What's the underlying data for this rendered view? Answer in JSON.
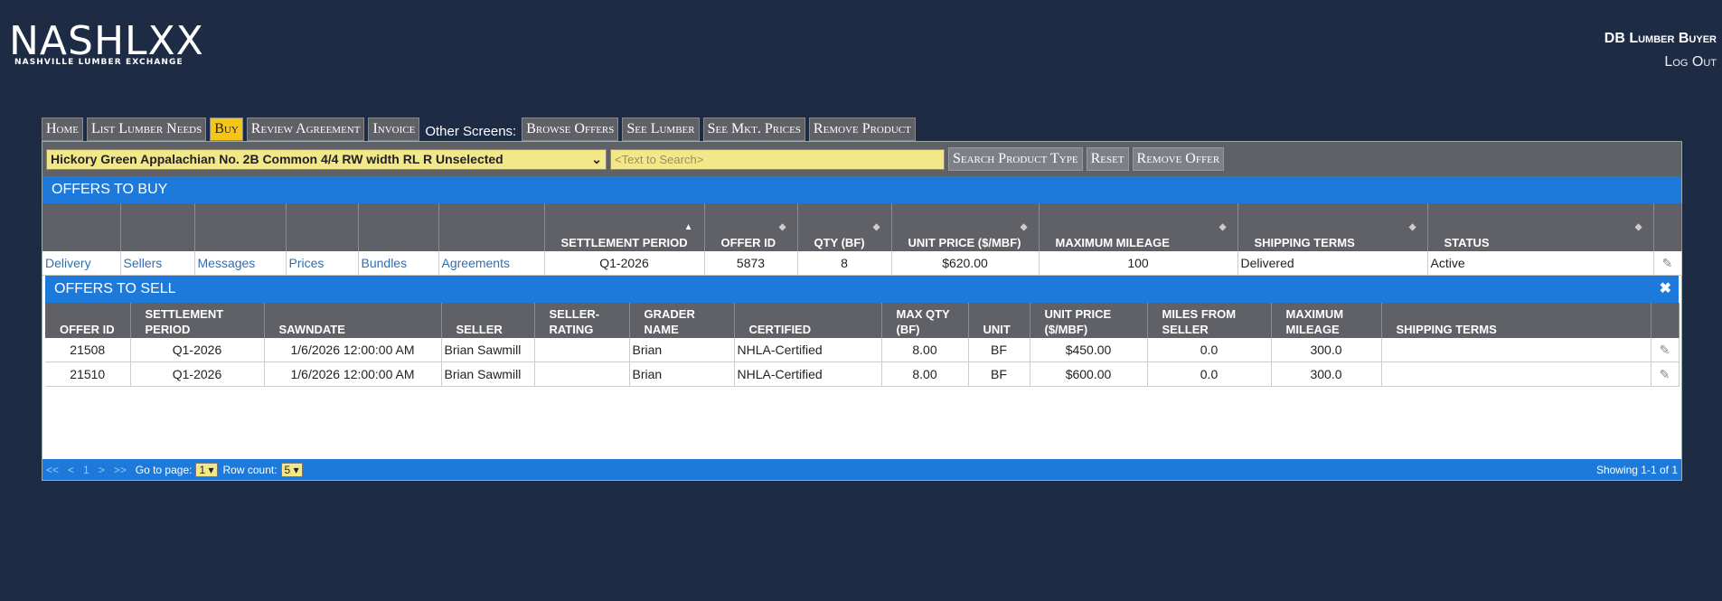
{
  "header": {
    "logo_main": "NASHLXX",
    "logo_sub": "NASHVILLE LUMBER EXCHANGE",
    "user_name": "DB Lumber Buyer",
    "logout": "Log Out"
  },
  "nav": {
    "tabs": [
      "Home",
      "List Lumber Needs",
      "Buy",
      "Review Agreement",
      "Invoice"
    ],
    "active": "Buy",
    "other_label": "Other Screens:",
    "other_tabs": [
      "Browse Offers",
      "See Lumber",
      "See Mkt. Prices",
      "Remove Product"
    ]
  },
  "search": {
    "product": "Hickory Green Appalachian No. 2B Common 4/4 RW width RL R Unselected",
    "placeholder": "<Text to Search>",
    "search_btn": "Search Product Type",
    "reset_btn": "Reset",
    "remove_btn": "Remove Offer"
  },
  "buy": {
    "title": "OFFERS TO BUY",
    "columns": [
      "",
      "",
      "",
      "",
      "",
      "",
      "SETTLEMENT PERIOD",
      "OFFER ID",
      "QTY (BF)",
      "UNIT PRICE ($/MBF)",
      "MAXIMUM MILEAGE",
      "SHIPPING TERMS",
      "STATUS",
      ""
    ],
    "links": [
      "Delivery",
      "Sellers",
      "Messages",
      "Prices",
      "Bundles",
      "Agreements"
    ],
    "row": {
      "period": "Q1-2026",
      "offer_id": "5873",
      "qty": "8",
      "price": "$620.00",
      "mileage": "100",
      "shipping": "Delivered",
      "status": "Active"
    }
  },
  "sell": {
    "title": "OFFERS TO SELL",
    "columns": [
      "OFFER ID",
      "SETTLEMENT PERIOD",
      "SAWNDATE",
      "SELLER",
      "SELLER-RATING",
      "GRADER NAME",
      "CERTIFIED",
      "MAX QTY (BF)",
      "UNIT",
      "UNIT PRICE ($/MBF)",
      "MILES FROM SELLER",
      "MAXIMUM MILEAGE",
      "SHIPPING TERMS"
    ],
    "rows": [
      [
        "21508",
        "Q1-2026",
        "1/6/2026 12:00:00 AM",
        "Brian Sawmill",
        "",
        "Brian",
        "NHLA-Certified",
        "8.00",
        "BF",
        "$450.00",
        "0.0",
        "300.0",
        ""
      ],
      [
        "21510",
        "Q1-2026",
        "1/6/2026 12:00:00 AM",
        "Brian Sawmill",
        "",
        "Brian",
        "NHLA-Certified",
        "8.00",
        "BF",
        "$600.00",
        "0.0",
        "300.0",
        ""
      ]
    ]
  },
  "footer": {
    "pager": [
      "<<",
      "<",
      "1",
      ">",
      ">>"
    ],
    "goto_label": "Go to page:",
    "goto_value": "1",
    "rows_label": "Row count:",
    "rows_value": "5",
    "showing": "Showing 1-1 of 1"
  }
}
